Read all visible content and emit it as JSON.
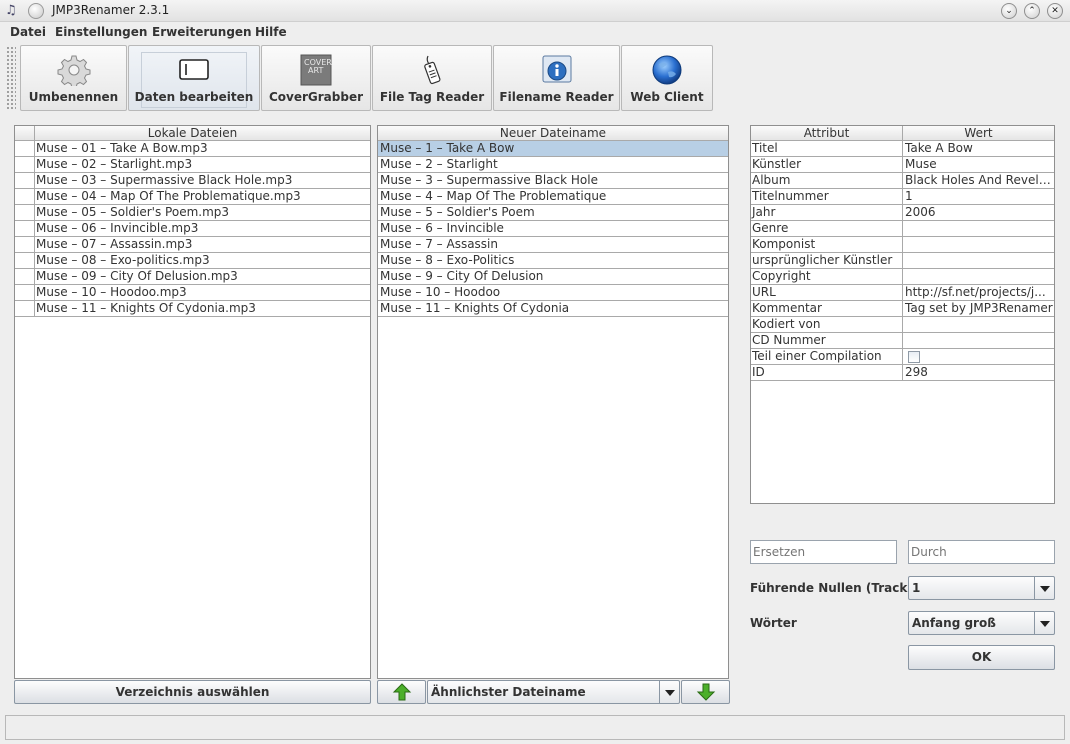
{
  "window": {
    "title": "JMP3Renamer 2.3.1"
  },
  "menu": [
    "Datei",
    "Einstellungen",
    "Erweiterungen",
    "Hilfe"
  ],
  "toolbar": {
    "buttons": [
      "Umbenennen",
      "Daten bearbeiten",
      "CoverGrabber",
      "File Tag Reader",
      "Filename Reader",
      "Web Client"
    ],
    "cover_icon_text": [
      "COVER",
      "ART"
    ],
    "selected": "Daten bearbeiten"
  },
  "local_files": {
    "header": "Lokale Dateien",
    "items": [
      "Muse – 01 – Take A Bow.mp3",
      "Muse – 02 – Starlight.mp3",
      "Muse – 03 – Supermassive Black Hole.mp3",
      "Muse – 04 – Map Of The Problematique.mp3",
      "Muse – 05 – Soldier's Poem.mp3",
      "Muse – 06 – Invincible.mp3",
      "Muse – 07 – Assassin.mp3",
      "Muse – 08 – Exo-politics.mp3",
      "Muse – 09 – City Of Delusion.mp3",
      "Muse – 10 – Hoodoo.mp3",
      "Muse – 11 – Knights Of Cydonia.mp3"
    ],
    "button": "Verzeichnis auswählen"
  },
  "new_names": {
    "header": "Neuer Dateiname",
    "items": [
      "Muse – 1 – Take A Bow",
      "Muse – 2 – Starlight",
      "Muse – 3 – Supermassive Black Hole",
      "Muse – 4 – Map Of The Problematique",
      "Muse – 5 – Soldier's Poem",
      "Muse – 6 – Invincible",
      "Muse – 7 – Assassin",
      "Muse – 8 – Exo-Politics",
      "Muse – 9 – City Of Delusion",
      "Muse – 10 – Hoodoo",
      "Muse – 11 – Knights Of Cydonia"
    ],
    "selected_index": 0,
    "combo_value": "Ähnlichster Dateiname"
  },
  "attributes": {
    "header_attr": "Attribut",
    "header_value": "Wert",
    "rows": [
      {
        "attr": "Titel",
        "value": "Take A Bow"
      },
      {
        "attr": "Künstler",
        "value": "Muse"
      },
      {
        "attr": "Album",
        "value": "Black Holes And Revela..."
      },
      {
        "attr": "Titelnummer",
        "value": "1"
      },
      {
        "attr": "Jahr",
        "value": "2006"
      },
      {
        "attr": "Genre",
        "value": ""
      },
      {
        "attr": "Komponist",
        "value": ""
      },
      {
        "attr": "ursprünglicher Künstler",
        "value": ""
      },
      {
        "attr": "Copyright",
        "value": ""
      },
      {
        "attr": "URL",
        "value": "http://sf.net/projects/j..."
      },
      {
        "attr": "Kommentar",
        "value": "Tag set by JMP3Renamer"
      },
      {
        "attr": "Kodiert von",
        "value": ""
      },
      {
        "attr": "CD Nummer",
        "value": ""
      },
      {
        "attr": "Teil einer Compilation",
        "value": ""
      },
      {
        "attr": "ID",
        "value": "298"
      }
    ],
    "checkbox_row": "Teil einer Compilation"
  },
  "replace": {
    "ersetzen_placeholder": "Ersetzen",
    "durch_placeholder": "Durch"
  },
  "options": {
    "leading_zeros_label": "Führende Nullen (Track)",
    "leading_zeros_value": "1",
    "words_label": "Wörter",
    "words_value": "Anfang groß",
    "ok_label": "OK"
  },
  "colors": {
    "selection": "#b8cfe5",
    "background": "#eeeeee",
    "arrow_green": "#4caf2a"
  }
}
